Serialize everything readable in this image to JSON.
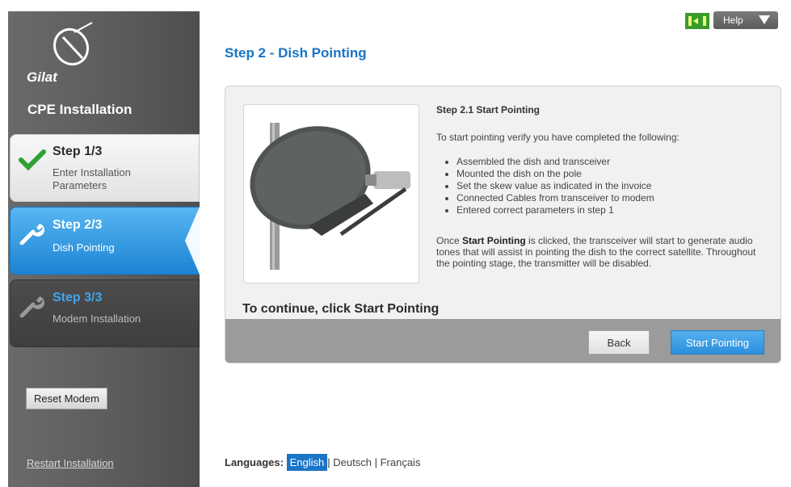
{
  "sidebar": {
    "logo_text": "Gilat",
    "title": "CPE Installation",
    "steps": [
      {
        "title": "Step 1/3",
        "subtitle": "Enter Installation Parameters",
        "state": "done",
        "icon": "checkmark-icon"
      },
      {
        "title": "Step 2/3",
        "subtitle": "Dish Pointing",
        "state": "active",
        "icon": "wrench-icon"
      },
      {
        "title": "Step 3/3",
        "subtitle": "Modem Installation",
        "state": "pending",
        "icon": "wrench-icon"
      }
    ],
    "reset_label": "Reset Modem",
    "restart_label": "Restart Installation"
  },
  "header": {
    "help_label": "Help",
    "connection_icon": "connection-status-icon"
  },
  "main": {
    "page_title": "Step 2 - Dish Pointing",
    "section_title": "Step 2.1 Start Pointing",
    "intro": "To start pointing verify you have completed the following:",
    "checklist": [
      "Assembled the dish and transceiver",
      "Mounted the dish on the pole",
      "Set the skew value as indicated in the invoice",
      "Connected Cables from transceiver to modem",
      "Entered correct parameters in step 1"
    ],
    "note_prefix": "Once ",
    "note_bold": "Start Pointing",
    "note_rest": " is clicked, the transceiver will start to generate audio tones that will assist in pointing the dish to the correct satellite. Throughout the pointing stage, the transmitter will be disabled.",
    "continue_text": "To continue, click Start Pointing",
    "back_label": "Back",
    "start_label": "Start Pointing"
  },
  "languages": {
    "label": "Languages:",
    "selected": "English",
    "others": [
      "Deutsch",
      "Français"
    ],
    "sep": "|"
  },
  "colors": {
    "accent": "#1674c6",
    "active_step": "#2b8fdc",
    "sidebar": "#5b5b5b",
    "check": "#2fa135"
  }
}
